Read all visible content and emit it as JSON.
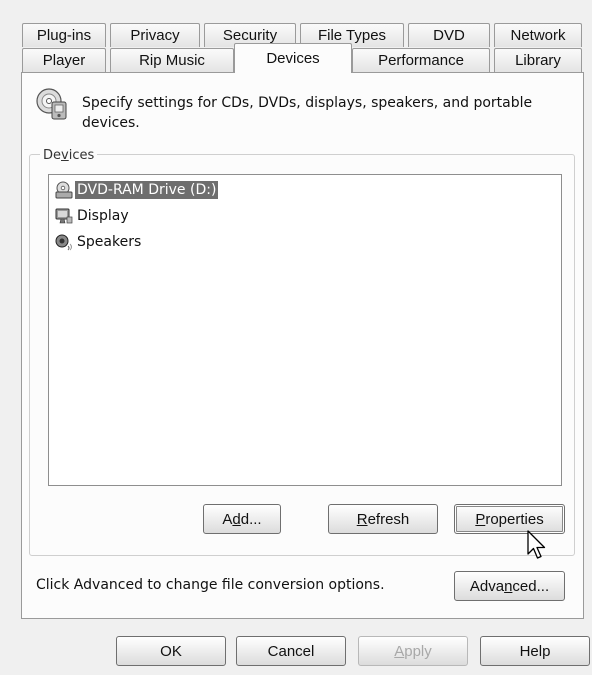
{
  "tabs_row1": [
    "Plug-ins",
    "Privacy",
    "Security",
    "File Types",
    "DVD",
    "Network"
  ],
  "tabs_row2": [
    "Player",
    "Rip Music",
    "Devices",
    "Performance",
    "Library"
  ],
  "active_tab": "Devices",
  "description": "Specify settings for CDs, DVDs, displays, speakers, and portable devices.",
  "devices_group": {
    "label_pre": "De",
    "label_key": "v",
    "label_post": "ices",
    "items": [
      {
        "label": "DVD-RAM Drive (D:)",
        "icon": "dvd-drive-icon",
        "selected": true
      },
      {
        "label": "Display",
        "icon": "display-icon",
        "selected": false
      },
      {
        "label": "Speakers",
        "icon": "speakers-icon",
        "selected": false
      }
    ],
    "add": {
      "pre": "A",
      "key": "d",
      "post": "d..."
    },
    "refresh": {
      "pre": "",
      "key": "R",
      "post": "efresh"
    },
    "properties": {
      "pre": "",
      "key": "P",
      "post": "roperties"
    }
  },
  "advanced_text": "Click Advanced to change file conversion options.",
  "advanced_button": {
    "pre": "Adva",
    "key": "n",
    "post": "ced..."
  },
  "dialog_buttons": {
    "ok": "OK",
    "cancel": "Cancel",
    "apply": {
      "pre": "",
      "key": "A",
      "post": "pply"
    },
    "help": "Help"
  },
  "colors": {
    "selection": "#6e6e6e",
    "panel": "#fcfcfc",
    "chrome": "#f0f0f0"
  }
}
